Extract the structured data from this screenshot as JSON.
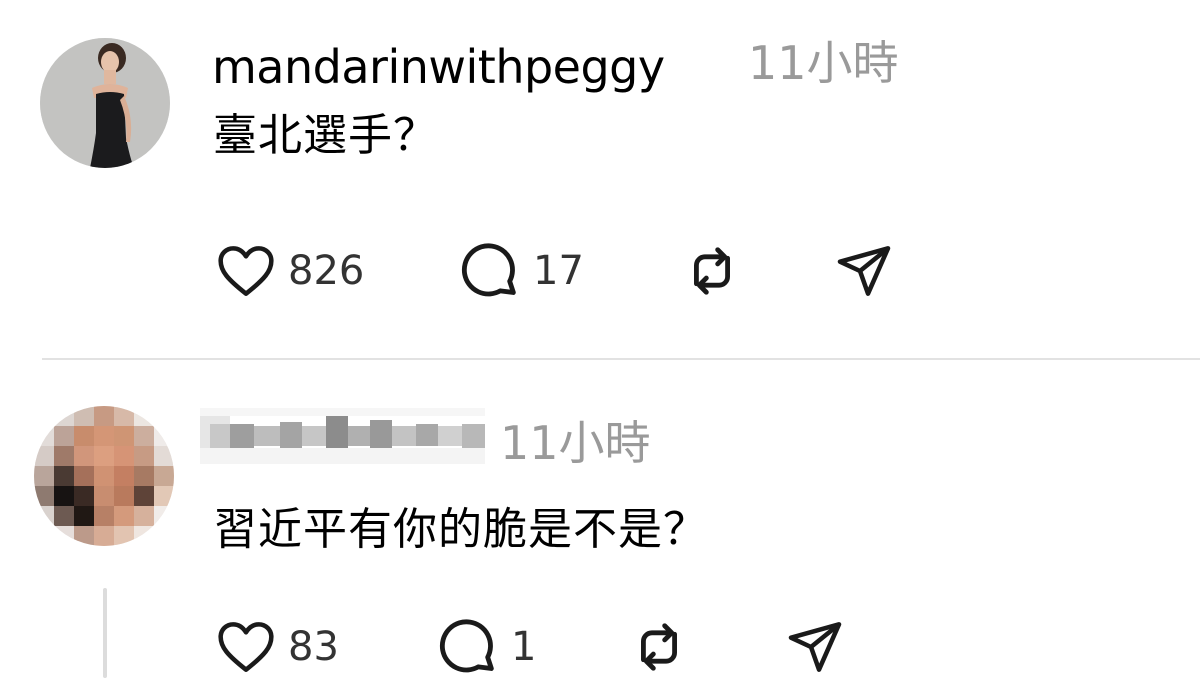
{
  "comments": [
    {
      "username": "mandarinwithpeggy",
      "time": "11小時",
      "text": "臺北選手？",
      "likes": "826",
      "replies": "17"
    },
    {
      "username": "",
      "time": "11小時",
      "text": "習近平有你的脆是不是？",
      "likes": "83",
      "replies": "1"
    }
  ],
  "icons": {
    "like": "heart-icon",
    "reply": "comment-bubble-icon",
    "repost": "repost-icon",
    "share": "send-icon"
  }
}
